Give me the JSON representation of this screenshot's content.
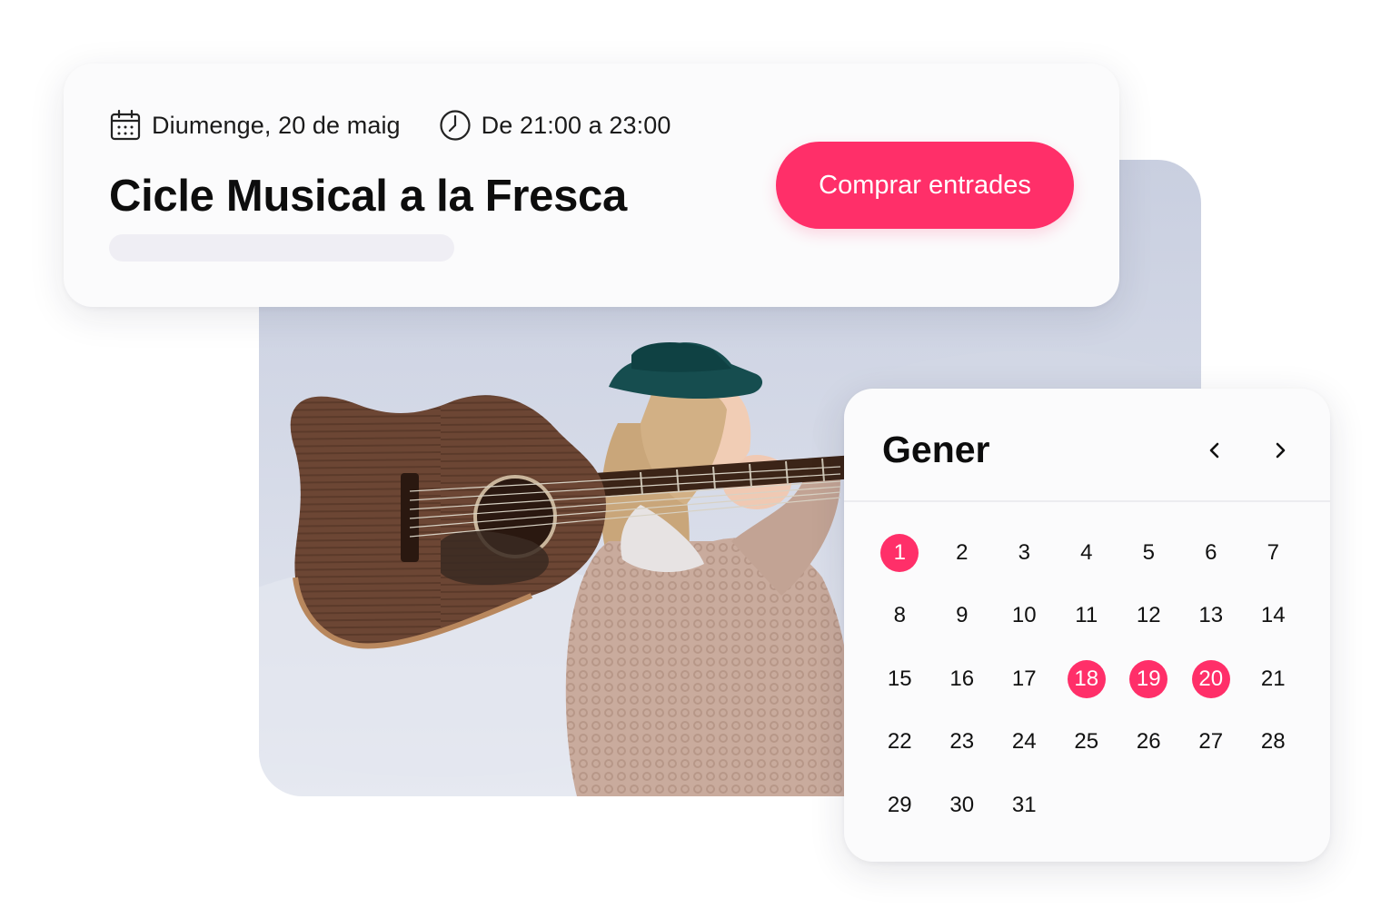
{
  "event": {
    "date_text": "Diumenge, 20 de maig",
    "time_text": "De 21:00 a 23:00",
    "title": "Cicle Musical a la Fresca",
    "buy_button_label": "Comprar entrades",
    "date_icon": "calendar-icon",
    "time_icon": "clock-icon"
  },
  "calendar": {
    "month": "Gener",
    "prev_icon": "chevron-left-icon",
    "next_icon": "chevron-right-icon",
    "days": [
      "1",
      "2",
      "3",
      "4",
      "5",
      "6",
      "7",
      "8",
      "9",
      "10",
      "11",
      "12",
      "13",
      "14",
      "15",
      "16",
      "17",
      "18",
      "19",
      "20",
      "21",
      "22",
      "23",
      "24",
      "25",
      "26",
      "27",
      "28",
      "29",
      "30",
      "31"
    ],
    "selected_days": [
      "1",
      "18",
      "19",
      "20"
    ]
  },
  "colors": {
    "accent": "#ff2f69",
    "card_background": "#fbfbfc",
    "placeholder_bar": "#efeef4"
  }
}
